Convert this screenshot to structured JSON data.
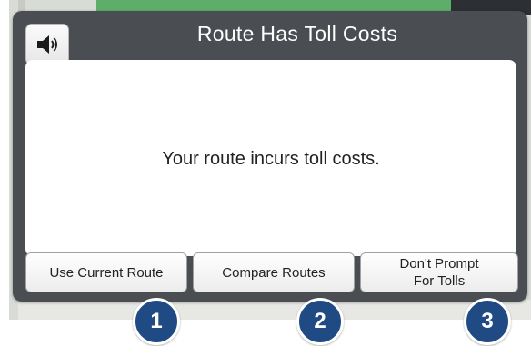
{
  "dialog": {
    "title": "Route Has Toll Costs",
    "message": "Your route incurs toll costs.",
    "speaker_icon": "speaker-volume-icon"
  },
  "buttons": {
    "use_current_route": "Use Current Route",
    "compare_routes": "Compare Routes",
    "dont_prompt_line1": "Don't Prompt",
    "dont_prompt_line2": "For Tolls"
  },
  "callouts": [
    "1",
    "2",
    "3"
  ],
  "colors": {
    "dialog_frame": "#4a4d51",
    "callout_fill": "#1f4a83",
    "panel": "#ffffff"
  }
}
